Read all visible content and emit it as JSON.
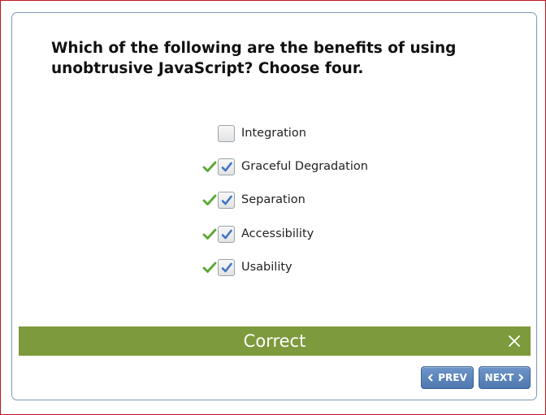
{
  "question": "Which of the following are the benefits of using unobtrusive JavaScript? Choose four.",
  "options": [
    {
      "label": "Integration",
      "checked": false,
      "correct_mark": false
    },
    {
      "label": "Graceful Degradation",
      "checked": true,
      "correct_mark": true
    },
    {
      "label": "Separation",
      "checked": true,
      "correct_mark": true
    },
    {
      "label": "Accessibility",
      "checked": true,
      "correct_mark": true
    },
    {
      "label": "Usability",
      "checked": true,
      "correct_mark": true
    }
  ],
  "feedback": {
    "text": "Correct",
    "close_icon": "close-icon"
  },
  "nav": {
    "prev_label": "PREV",
    "next_label": "NEXT"
  },
  "colors": {
    "feedback_bar": "#7d9a3c",
    "button": "#5b83b9",
    "checkmark": "#3f74c4",
    "correct_tick": "#5aa832",
    "border": "#c0171c"
  }
}
